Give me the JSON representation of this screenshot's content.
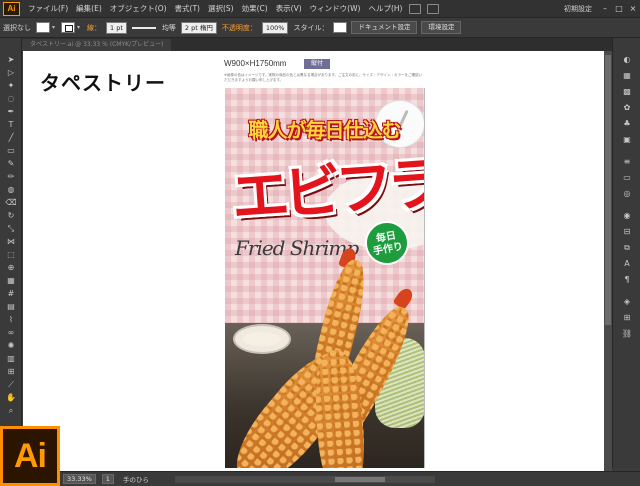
{
  "app": {
    "logo": "Ai",
    "workspace": "初期設定"
  },
  "menu": [
    "ファイル(F)",
    "編集(E)",
    "オブジェクト(O)",
    "書式(T)",
    "選択(S)",
    "効果(C)",
    "表示(V)",
    "ウィンドウ(W)",
    "ヘルプ(H)"
  ],
  "control": {
    "selection": "選択なし",
    "stroke_label": "線：",
    "stroke_value": "1 pt",
    "line_style": "均等",
    "brush": "2 pt 楕円",
    "opacity_label": "不透明度：",
    "opacity_value": "100%",
    "style_label": "スタイル：",
    "doc_setup": "ドキュメント設定",
    "prefs": "環境設定"
  },
  "tab": {
    "title": "タペストリー.ai @ 33.33 % (CMYK/プレビュー)"
  },
  "canvas": {
    "heading": "タペストリー",
    "size": "W900×H1750mm",
    "badge": "縦付",
    "note": "※画像の色はイメージです。実際の商品の色とは異なる場合があります。ご注文の前に、サイズ・デザイン・カラーをご確認いただきますようお願い申し上げます。"
  },
  "poster": {
    "tagline": "職人が毎日仕込む",
    "title": "エビフライ",
    "badge_top": "毎日",
    "badge_bottom": "手作り",
    "script": "Fried Shrimp"
  },
  "status": {
    "zoom": "33.33%",
    "page": "1",
    "tool": "手のひら"
  },
  "colors": {
    "accent": "#ff9a00",
    "title_red": "#e4141c",
    "tagline_yellow": "#ffd33a",
    "badge_green": "#1e9c3e"
  }
}
